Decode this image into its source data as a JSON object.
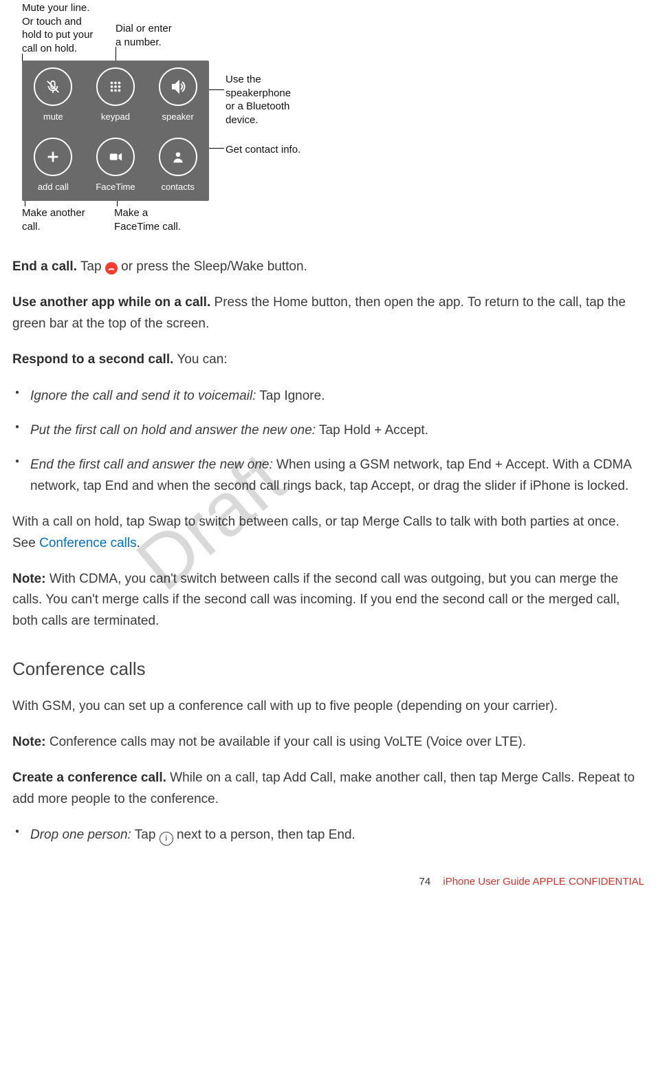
{
  "figure": {
    "callouts": {
      "mute": "Mute your line.\nOr touch and\nhold to put your\ncall on hold.",
      "keypad": "Dial or enter\na number.",
      "speaker": "Use the\nspeakerphone\nor a Bluetooth\ndevice.",
      "contacts": "Get contact info.",
      "addcall": "Make another\ncall.",
      "facetime": "Make a\nFaceTime call."
    },
    "buttons": {
      "mute": "mute",
      "keypad": "keypad",
      "speaker": "speaker",
      "addcall": "add call",
      "facetime": "FaceTime",
      "contacts": "contacts"
    }
  },
  "p1": {
    "strong": "End a call.",
    "t1": " Tap ",
    "t2": " or press the Sleep/Wake button."
  },
  "p2": {
    "strong": "Use another app while on a call.",
    "text": " Press the Home button, then open the app. To return to the call, tap the green bar at the top of the screen."
  },
  "p3": {
    "strong": "Respond to a second call.",
    "text": " You can:"
  },
  "bul1": {
    "ital": "Ignore the call and send it to voicemail:",
    "text": " Tap Ignore."
  },
  "bul2": {
    "ital": "Put the first call on hold and answer the new one:",
    "text": " Tap Hold + Accept."
  },
  "bul3": {
    "ital": "End the first call and answer the new one:",
    "text": " When using a GSM network, tap End + Accept. With a CDMA network, tap End and when the second call rings back, tap Accept, or drag the slider if iPhone is locked."
  },
  "p4": {
    "t1": "With a call on hold, tap Swap to switch between calls, or tap Merge Calls to talk with both parties at once. See ",
    "link": "Conference calls",
    "t2": "."
  },
  "p5": {
    "strong": "Note:",
    "text": " With CDMA, you can't switch between calls if the second call was outgoing, but you can merge the calls. You can't merge calls if the second call was incoming. If you end the second call or the merged call, both calls are terminated."
  },
  "h2": "Conference calls",
  "p6": "With GSM, you can set up a conference call with up to five people (depending on your carrier).",
  "p7": {
    "strong": "Note:",
    "text": " Conference calls may not be available if your call is using VoLTE (Voice over LTE)."
  },
  "p8": {
    "strong": "Create a conference call.",
    "text": " While on a call, tap Add Call, make another call, then tap Merge Calls. Repeat to add more people to the conference."
  },
  "bul4": {
    "ital": "Drop one person:",
    "t1": " Tap ",
    "t2": " next to a person, then tap End."
  },
  "watermark": "Draft",
  "footer": {
    "page": "74",
    "text": "iPhone User Guide  APPLE CONFIDENTIAL"
  },
  "info_glyph": "i"
}
